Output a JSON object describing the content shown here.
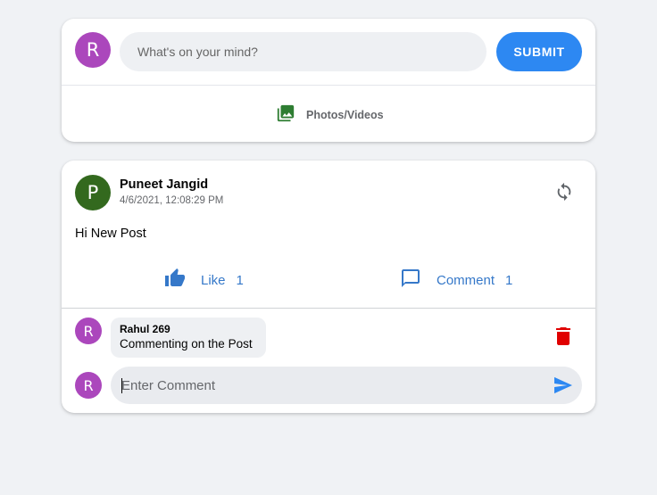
{
  "colors": {
    "page_bg": "#f0f2f5",
    "accent": "#2d88f2",
    "action_blue": "#3578c9",
    "avatar_purple": "#ab47bc",
    "avatar_green": "#33691e",
    "media_green": "#2e7d32",
    "delete_red": "#e00000"
  },
  "composer": {
    "avatar_initial": "R",
    "placeholder": "What's on your mind?",
    "submit_label": "SUBMIT",
    "media_icon": "photo-library-icon",
    "media_label": "Photos/Videos"
  },
  "post": {
    "author_initial": "P",
    "author_name": "Puneet Jangid",
    "timestamp": "4/6/2021, 12:08:29 PM",
    "refresh_icon": "sync-icon",
    "text": "Hi New Post",
    "like": {
      "icon": "thumb-up-icon",
      "label": "Like",
      "count": "1"
    },
    "comment": {
      "icon": "comment-icon",
      "label": "Comment",
      "count": "1"
    },
    "comments": [
      {
        "avatar_initial": "R",
        "author": "Rahul 269",
        "text": "Commenting on the Post",
        "delete_icon": "trash-icon"
      }
    ],
    "reply": {
      "avatar_initial": "R",
      "placeholder": "Enter Comment",
      "send_icon": "send-icon"
    }
  }
}
